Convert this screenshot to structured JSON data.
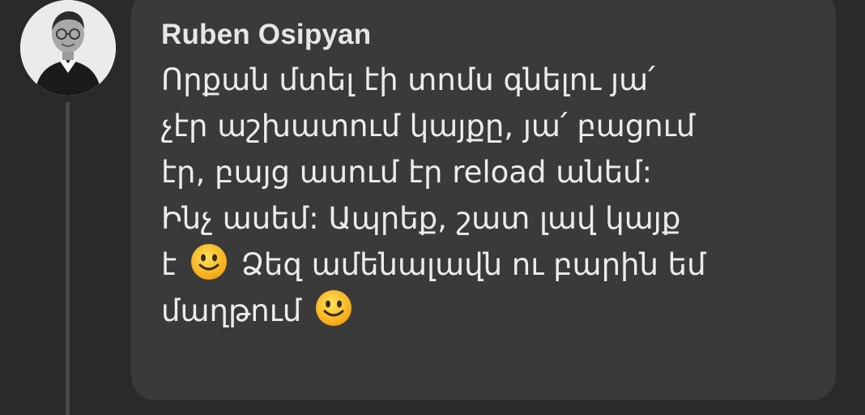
{
  "comment": {
    "author": "Ruben Osipyan",
    "lines": [
      "Որքան մտել էի տոմս գնելու յա՛",
      "չէր աշխատում կայքը, յա՛ բացում",
      "էր, բայց ասում էր reload անեմ:",
      "Ինչ ասեմ: Ապրեք, շատ լավ կայք",
      "է",
      "Ձեզ ամենալավն ու բարին եմ",
      "մաղթում"
    ],
    "emoji": "smiling-face"
  },
  "colors": {
    "background": "#2a2a2a",
    "bubble": "#3a3a3b",
    "text": "#ececec",
    "thread_line": "#4a4a4a"
  }
}
